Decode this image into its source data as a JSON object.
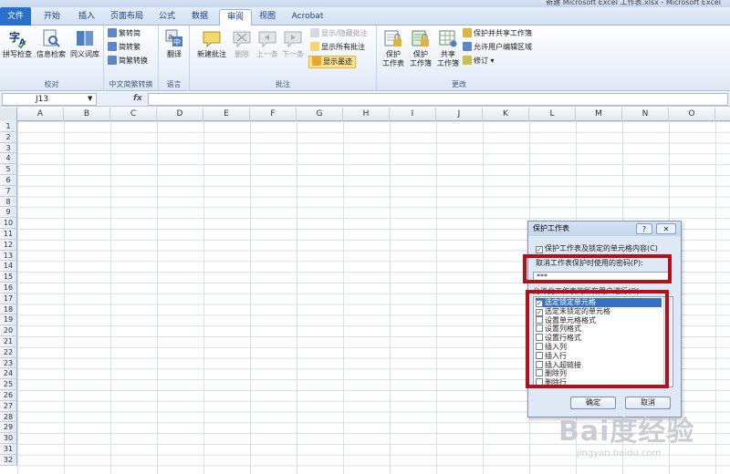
{
  "window": {
    "title": "新建 Microsoft Excel 工作表.xlsx - Microsoft Excel"
  },
  "tabs": [
    "文件",
    "开始",
    "插入",
    "页面布局",
    "公式",
    "数据",
    "审阅",
    "视图",
    "Acrobat"
  ],
  "ribbon": {
    "proofing": {
      "label": "校对",
      "spell": "拼写检查",
      "research": "信息检索",
      "thesaurus": "同义词库"
    },
    "chinese": {
      "label": "中文简繁转换",
      "to_trad": "繁转简",
      "to_simp": "简转繁",
      "convert": "简繁转换"
    },
    "language": {
      "label": "语言",
      "translate": "翻译"
    },
    "comments": {
      "label": "批注",
      "new": "新建批注",
      "delete": "删除",
      "prev": "上一条",
      "next": "下一条",
      "show_hide": "显示/隐藏批注",
      "show_all": "显示所有批注",
      "show_ink": "显示墨迹"
    },
    "changes": {
      "label": "更改",
      "protect_sheet": [
        "保护",
        "工作表"
      ],
      "protect_book": [
        "保护",
        "工作簿"
      ],
      "share_book": [
        "共享",
        "工作簿"
      ],
      "protect_share": "保护并共享工作簿",
      "allow_edit": "允许用户编辑区域",
      "track": "修订"
    }
  },
  "formula_bar": {
    "name_box": "J13",
    "fx": "fx",
    "value": ""
  },
  "columns": [
    "A",
    "B",
    "C",
    "D",
    "E",
    "F",
    "G",
    "H",
    "I",
    "J",
    "K",
    "L",
    "M",
    "N",
    "O"
  ],
  "rows": [
    "1",
    "2",
    "3",
    "4",
    "5",
    "6",
    "7",
    "8",
    "9",
    "10",
    "11",
    "12",
    "13",
    "14",
    "15",
    "16",
    "17",
    "18",
    "19",
    "20",
    "21",
    "22",
    "23",
    "24",
    "25",
    "26",
    "27",
    "28",
    "29",
    "30",
    "31",
    "32"
  ],
  "dialog": {
    "title": "保护工作表",
    "help": "?",
    "close": "✕",
    "protect_check_label": "保护工作表及锁定的单元格内容(C)",
    "password_label": "取消工作表保护时使用的密码(P):",
    "password_value": "***",
    "permissions_label": "允许此工作表的所有用户进行(O):",
    "permissions": [
      {
        "label": "选定锁定单元格",
        "checked": true,
        "selected": true
      },
      {
        "label": "选定未锁定的单元格",
        "checked": true,
        "selected": false
      },
      {
        "label": "设置单元格格式",
        "checked": false,
        "selected": false
      },
      {
        "label": "设置列格式",
        "checked": false,
        "selected": false
      },
      {
        "label": "设置行格式",
        "checked": false,
        "selected": false
      },
      {
        "label": "插入列",
        "checked": false,
        "selected": false
      },
      {
        "label": "插入行",
        "checked": false,
        "selected": false
      },
      {
        "label": "插入超链接",
        "checked": false,
        "selected": false
      },
      {
        "label": "删除列",
        "checked": false,
        "selected": false
      },
      {
        "label": "删除行",
        "checked": false,
        "selected": false
      }
    ],
    "ok": "确定",
    "cancel": "取消"
  },
  "watermark": {
    "logo": "Bai度经验",
    "url": "jingyan.baidu.com"
  }
}
